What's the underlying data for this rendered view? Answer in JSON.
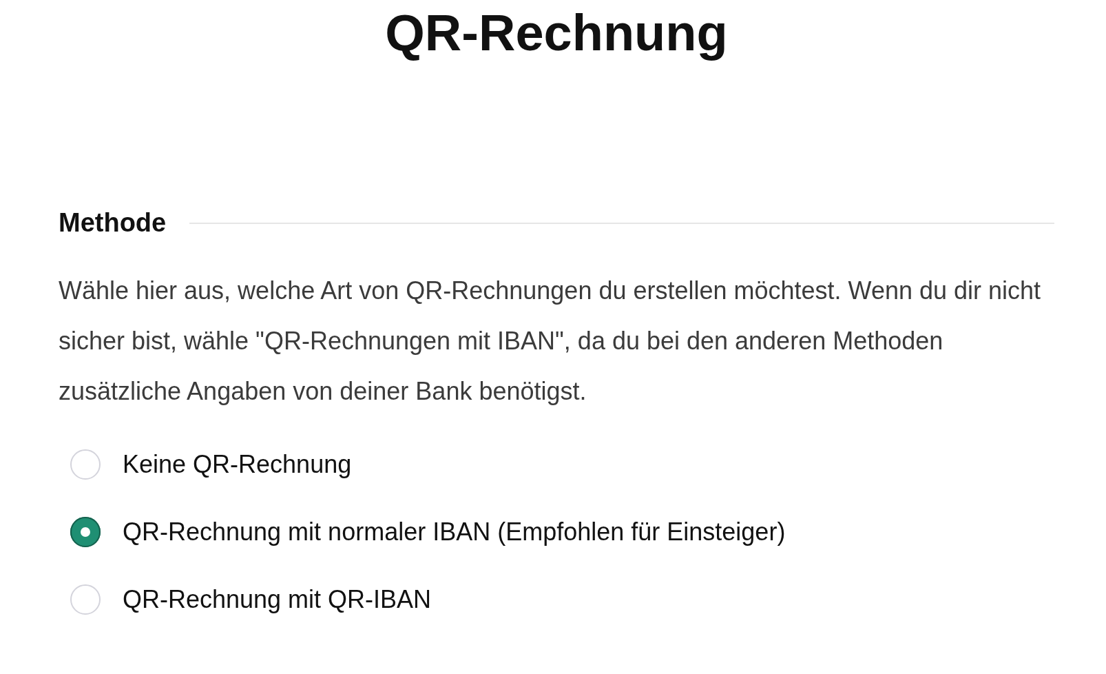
{
  "title": "QR-Rechnung",
  "section": {
    "heading": "Methode",
    "description": "Wähle hier aus, welche Art von QR-Rechnungen du erstellen möchtest. Wenn du dir nicht sicher bist, wähle \"QR-Rechnungen mit IBAN\", da du bei den anderen Methoden zusätzliche Angaben von deiner Bank benötigst.",
    "options": [
      {
        "label": "Keine QR-Rechnung",
        "selected": false
      },
      {
        "label": "QR-Rechnung mit normaler IBAN (Empfohlen für Einsteiger)",
        "selected": true
      },
      {
        "label": "QR-Rechnung mit QR-IBAN",
        "selected": false
      }
    ]
  }
}
